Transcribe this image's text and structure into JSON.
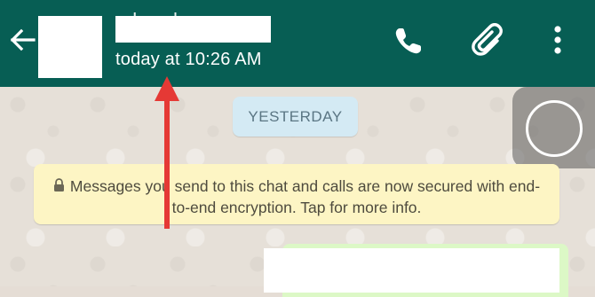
{
  "header": {
    "contact_name_partial": "ahaaha",
    "last_seen": "today at 10:26 AM"
  },
  "chat": {
    "date_chip": "YESTERDAY",
    "encryption_notice": "Messages you send to this chat and calls are now secured with end-to-end encryption. Tap for more info."
  },
  "icons": {
    "back": "arrow-left",
    "call": "phone-handset",
    "attach": "paperclip",
    "menu": "three-dot-vertical",
    "lock": "lock",
    "overlay": "circle-ring"
  },
  "colors": {
    "header_bg": "#075e54",
    "chip_bg": "#d4eaf4",
    "notice_bg": "#fdf5c4",
    "outgoing_bg": "#dcf8c6",
    "annotation": "#e53935"
  }
}
